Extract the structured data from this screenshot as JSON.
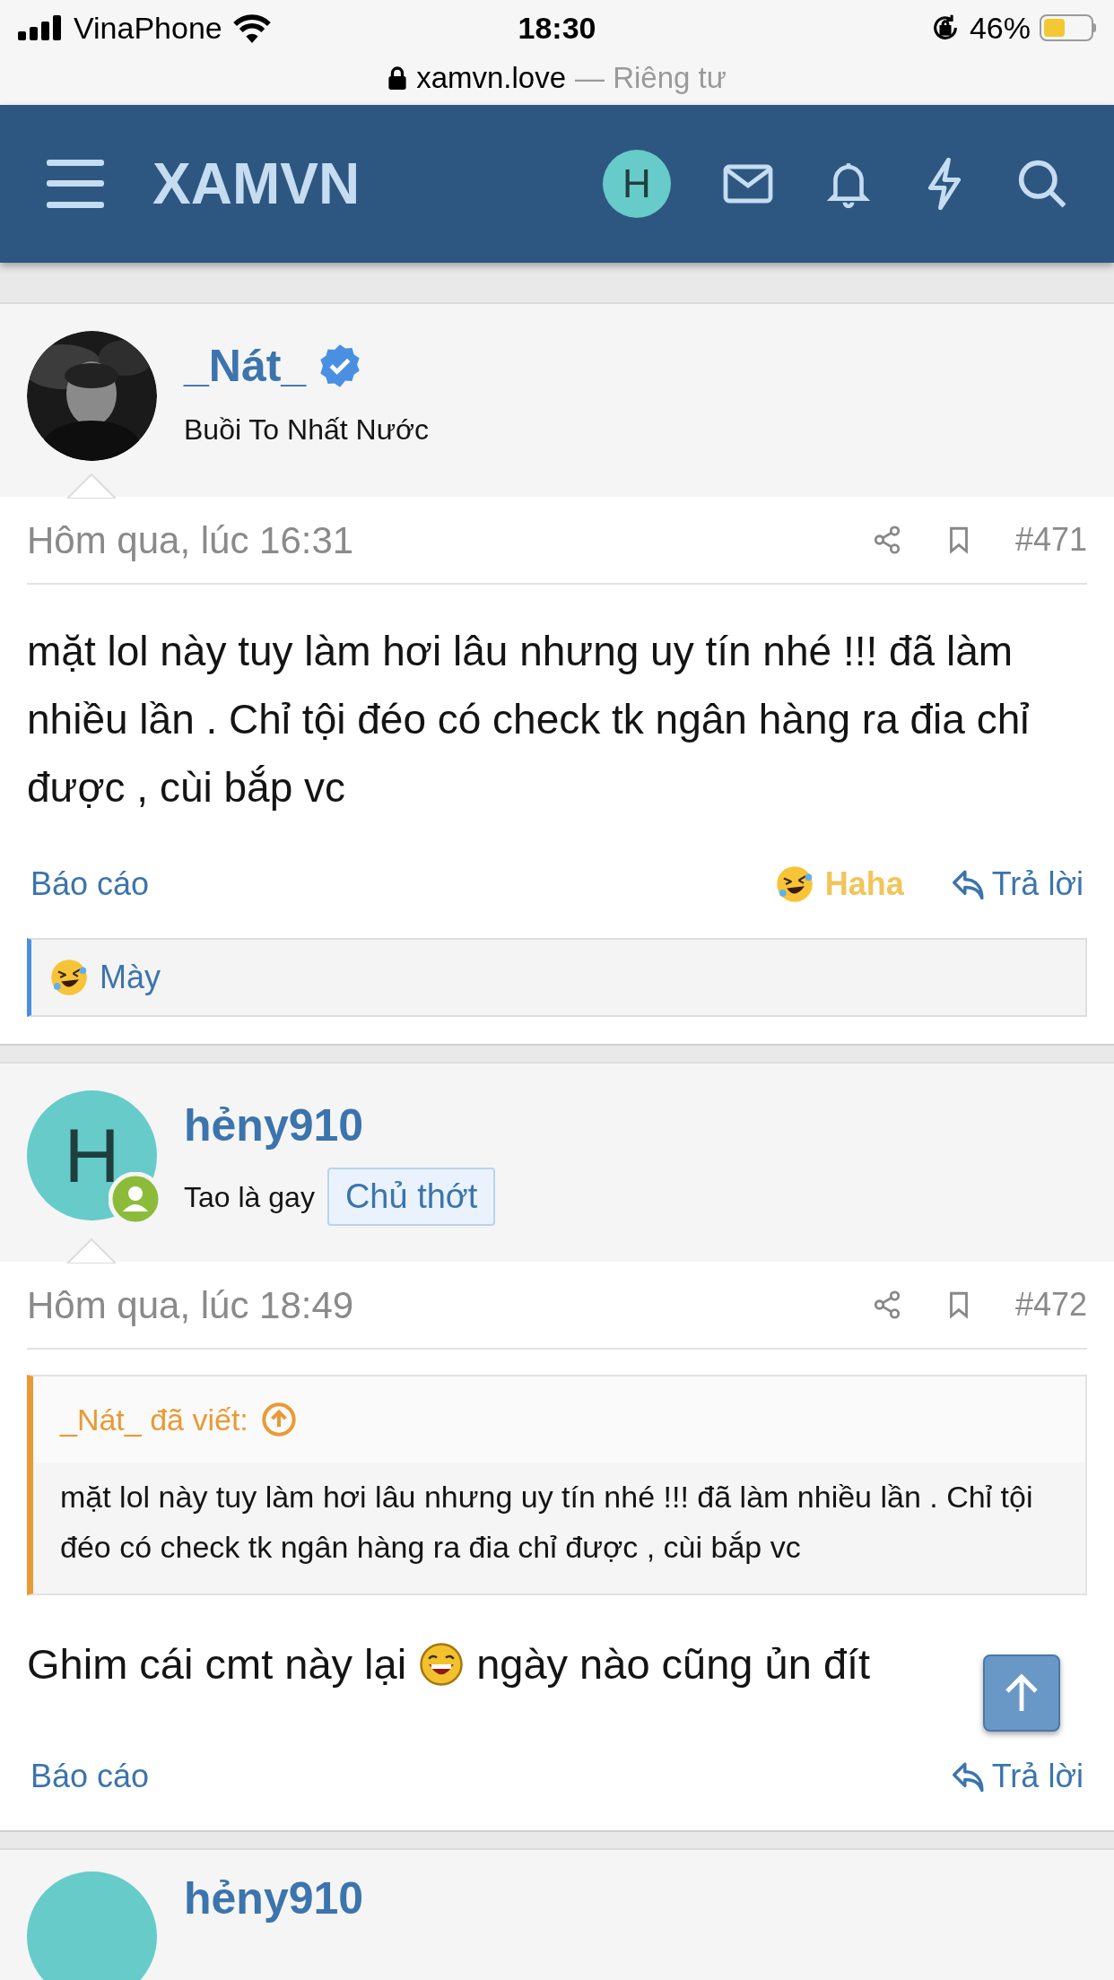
{
  "status_bar": {
    "carrier": "VinaPhone",
    "time": "18:30",
    "battery": "46%"
  },
  "address_bar": {
    "domain": "xamvn.love",
    "privacy": "— Riêng tư"
  },
  "header": {
    "logo": "XAMVN",
    "avatar_letter": "H"
  },
  "posts": [
    {
      "author": "_Nát_",
      "verified": true,
      "user_title": "Buồi To Nhất Nước",
      "date": "Hôm qua, lúc 16:31",
      "number": "#471",
      "body": "mặt lol này tuy làm hơi lâu nhưng uy tín nhé !!! đã làm nhiều lần . Chỉ tội đéo có check tk ngân hàng ra đia chỉ được , cùi bắp vc",
      "report": "Báo cáo",
      "reaction_button": "Haha",
      "reply": "Trả lời",
      "reactions": {
        "names": "Mày"
      }
    },
    {
      "author": "hẻny910",
      "avatar": {
        "kind": "letter",
        "letter": "H"
      },
      "user_title": "Tao là gay",
      "badge": "Chủ thớt",
      "online": true,
      "date": "Hôm qua, lúc 18:49",
      "number": "#472",
      "quote": {
        "author": "_Nát_ đã viết:",
        "text": "mặt lol này tuy làm hơi lâu nhưng uy tín nhé !!! đã làm nhiều lần . Chỉ tội đéo có check tk ngân hàng ra đia chỉ được , cùi bắp vc"
      },
      "body_before": "Ghim cái cmt này lại",
      "body_after": "ngày nào cũng ủn đít",
      "report": "Báo cáo",
      "reply": "Trả lời"
    }
  ],
  "next_post": {
    "author": "hẻny910"
  }
}
